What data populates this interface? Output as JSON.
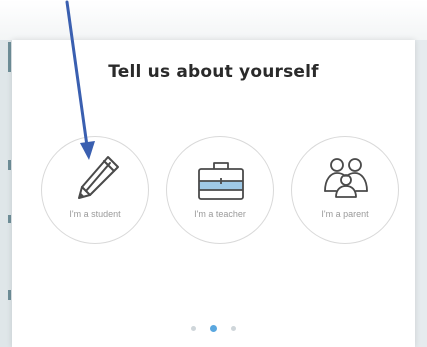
{
  "modal": {
    "title": "Tell us about yourself"
  },
  "options": [
    {
      "label": "I'm a student",
      "icon": "pencil-icon"
    },
    {
      "label": "I'm a teacher",
      "icon": "briefcase-icon"
    },
    {
      "label": "I'm a parent",
      "icon": "family-icon"
    }
  ],
  "pagination": {
    "total": 3,
    "active_index": 1
  },
  "colors": {
    "accent": "#5aa7df",
    "annotation_arrow": "#3a5fb0",
    "icon_stroke": "#4a4a4a",
    "briefcase_band": "#9fc9e6"
  }
}
